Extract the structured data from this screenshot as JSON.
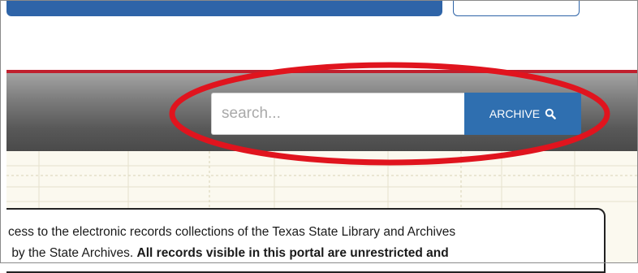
{
  "header": {
    "top_bar_color": "#2e64a8",
    "accent_rule_color": "#c0202e"
  },
  "search": {
    "placeholder": "search...",
    "button_label": "ARCHIVE",
    "button_color": "#2f6fb0",
    "button_icon": "search-icon"
  },
  "annotation": {
    "highlight_color": "#e0141e",
    "shape": "ellipse"
  },
  "notice": {
    "line1": "cess to the electronic records collections of the Texas State Library and Archives",
    "line2_prefix": "by the State Archives.",
    "line2_bold": "All records visible in this portal are unrestricted and"
  }
}
